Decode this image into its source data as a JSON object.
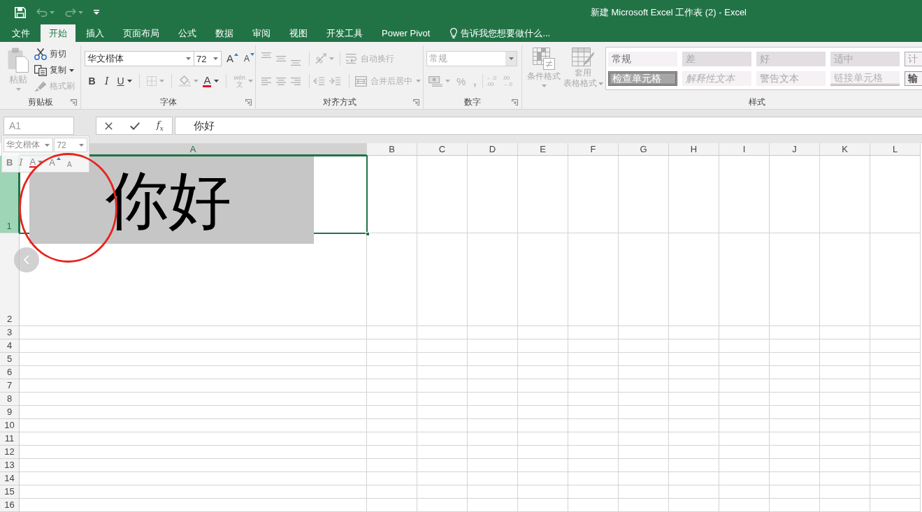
{
  "window": {
    "title": "新建 Microsoft Excel 工作表 (2) - Excel"
  },
  "quick_access": [
    {
      "kind": "save",
      "disabled": false
    },
    {
      "kind": "undo",
      "disabled": true
    },
    {
      "kind": "redo",
      "disabled": true
    },
    {
      "kind": "customize",
      "disabled": false
    }
  ],
  "tabs": [
    {
      "label": "文件",
      "selected": false
    },
    {
      "label": "开始",
      "selected": true
    },
    {
      "label": "插入",
      "selected": false
    },
    {
      "label": "页面布局",
      "selected": false
    },
    {
      "label": "公式",
      "selected": false
    },
    {
      "label": "数据",
      "selected": false
    },
    {
      "label": "审阅",
      "selected": false
    },
    {
      "label": "视图",
      "selected": false
    },
    {
      "label": "开发工具",
      "selected": false
    },
    {
      "label": "Power Pivot",
      "selected": false
    }
  ],
  "tell_me": {
    "placeholder": "告诉我您想要做什么..."
  },
  "ribbon": {
    "clipboard": {
      "label": "剪贴板",
      "paste": {
        "label": "粘贴",
        "disabled": true
      },
      "cut": {
        "label": "剪切",
        "disabled": false
      },
      "copy": {
        "label": "复制",
        "disabled": false
      },
      "format_painter": {
        "label": "格式刷",
        "disabled": true
      }
    },
    "font": {
      "label": "字体",
      "font_name": "华文楷体",
      "font_size": "72",
      "grow": {
        "label": "A"
      },
      "shrink": {
        "label": "A"
      },
      "bold": {
        "label": "B"
      },
      "italic": {
        "label": "I"
      },
      "underline": {
        "label": "U"
      },
      "borders": {
        "disabled": true
      },
      "fill_color": {
        "disabled": true
      },
      "font_color": {
        "label": "A",
        "disabled": false
      },
      "phonetic": {
        "label": "wén",
        "char": "文",
        "disabled": true
      }
    },
    "alignment": {
      "label": "对齐方式",
      "disabled": true,
      "wrap_text": "自动换行",
      "merge_center": "合并后居中"
    },
    "number": {
      "label": "数字",
      "disabled": true,
      "format": "常规",
      "percent": "%",
      "comma": ",",
      "increase_decimal": [
        "←.0",
        ".00"
      ],
      "decrease_decimal": [
        ".00",
        "→.0"
      ]
    },
    "styles": {
      "label": "样式",
      "disabled": true,
      "conditional_formatting": "条件格式",
      "format_as_table": [
        "套用",
        "表格格式"
      ],
      "gallery": [
        {
          "kind": "normal",
          "label": "常规"
        },
        {
          "kind": "bad",
          "label": "差"
        },
        {
          "kind": "good",
          "label": "好"
        },
        {
          "kind": "neutral",
          "label": "适中"
        },
        {
          "kind": "calculation",
          "label": "计"
        },
        {
          "kind": "check",
          "label": "检查单元格"
        },
        {
          "kind": "explanatory",
          "label": "解释性文本"
        },
        {
          "kind": "warning",
          "label": "警告文本"
        },
        {
          "kind": "linked",
          "label": "链接单元格"
        },
        {
          "kind": "output",
          "label": "输"
        }
      ]
    }
  },
  "name_box": {
    "value": "A1"
  },
  "formula_bar": {
    "buttons": [
      {
        "kind": "cancel"
      },
      {
        "kind": "enter"
      },
      {
        "kind": "function",
        "label": "f$_{x}$"
      }
    ],
    "value": "你好"
  },
  "sheet": {
    "columns": [
      {
        "label": "A",
        "selected": true
      },
      {
        "label": "B",
        "selected": false
      },
      {
        "label": "C",
        "selected": false
      },
      {
        "label": "D",
        "selected": false
      },
      {
        "label": "E",
        "selected": false
      },
      {
        "label": "F",
        "selected": false
      },
      {
        "label": "G",
        "selected": false
      },
      {
        "label": "H",
        "selected": false
      },
      {
        "label": "I",
        "selected": false
      },
      {
        "label": "J",
        "selected": false
      },
      {
        "label": "K",
        "selected": false
      },
      {
        "label": "L",
        "selected": false
      }
    ],
    "rows": [
      {
        "label": "1",
        "selected": true
      },
      {
        "label": "2",
        "selected": false
      },
      {
        "label": "3",
        "selected": false
      },
      {
        "label": "4",
        "selected": false
      },
      {
        "label": "5",
        "selected": false
      },
      {
        "label": "6",
        "selected": false
      },
      {
        "label": "7",
        "selected": false
      },
      {
        "label": "8",
        "selected": false
      },
      {
        "label": "9",
        "selected": false
      },
      {
        "label": "10",
        "selected": false
      },
      {
        "label": "11",
        "selected": false
      },
      {
        "label": "12",
        "selected": false
      },
      {
        "label": "13",
        "selected": false
      },
      {
        "label": "14",
        "selected": false
      },
      {
        "label": "15",
        "selected": false
      },
      {
        "label": "16",
        "selected": false
      }
    ],
    "active_cell": {
      "value": "你好",
      "highlighted": true
    }
  },
  "mini_toolbar": {
    "font_name": "华文楷体",
    "font_size": "72",
    "buttons": [
      {
        "kind": "bold",
        "label": "B"
      },
      {
        "kind": "italic",
        "label": "I"
      },
      {
        "kind": "font_color",
        "label": "A"
      },
      {
        "kind": "grow",
        "label": "A"
      },
      {
        "kind": "shrink",
        "label": "A"
      }
    ]
  },
  "annotations": [
    {
      "kind": "ellipse"
    }
  ],
  "page_controls": [
    {
      "kind": "previous"
    }
  ]
}
